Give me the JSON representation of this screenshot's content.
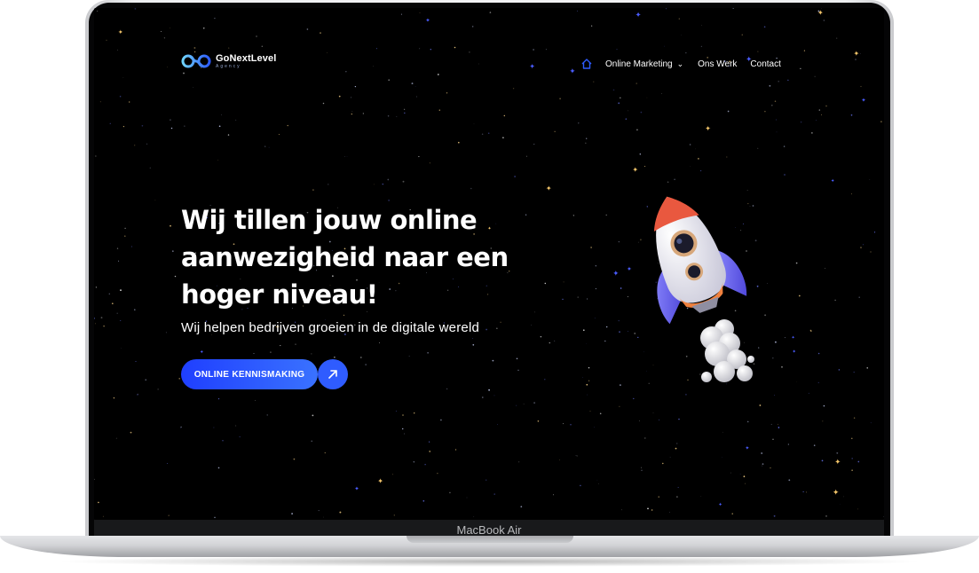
{
  "logo": {
    "name": "GoNextLevel",
    "sub": "Agency"
  },
  "nav": {
    "items": [
      {
        "label": "Online Marketing",
        "has_dropdown": true
      },
      {
        "label": "Ons Werk"
      },
      {
        "label": "Contact"
      }
    ],
    "home_icon": "home-icon",
    "accent": "#2d5bff"
  },
  "hero": {
    "title_lines": [
      "Wij tillen jouw online",
      "aanwezigheid naar een",
      "hoger niveau!"
    ],
    "subtitle": "Wij helpen bedrijven groeien in de digitale wereld",
    "cta_label": "ONLINE KENNISMAKING",
    "cta_icon": "arrow-up-right-icon"
  },
  "device": {
    "label": "MacBook Air"
  },
  "colors": {
    "background": "#000000",
    "button": "#2f5cff",
    "text": "#ffffff"
  }
}
